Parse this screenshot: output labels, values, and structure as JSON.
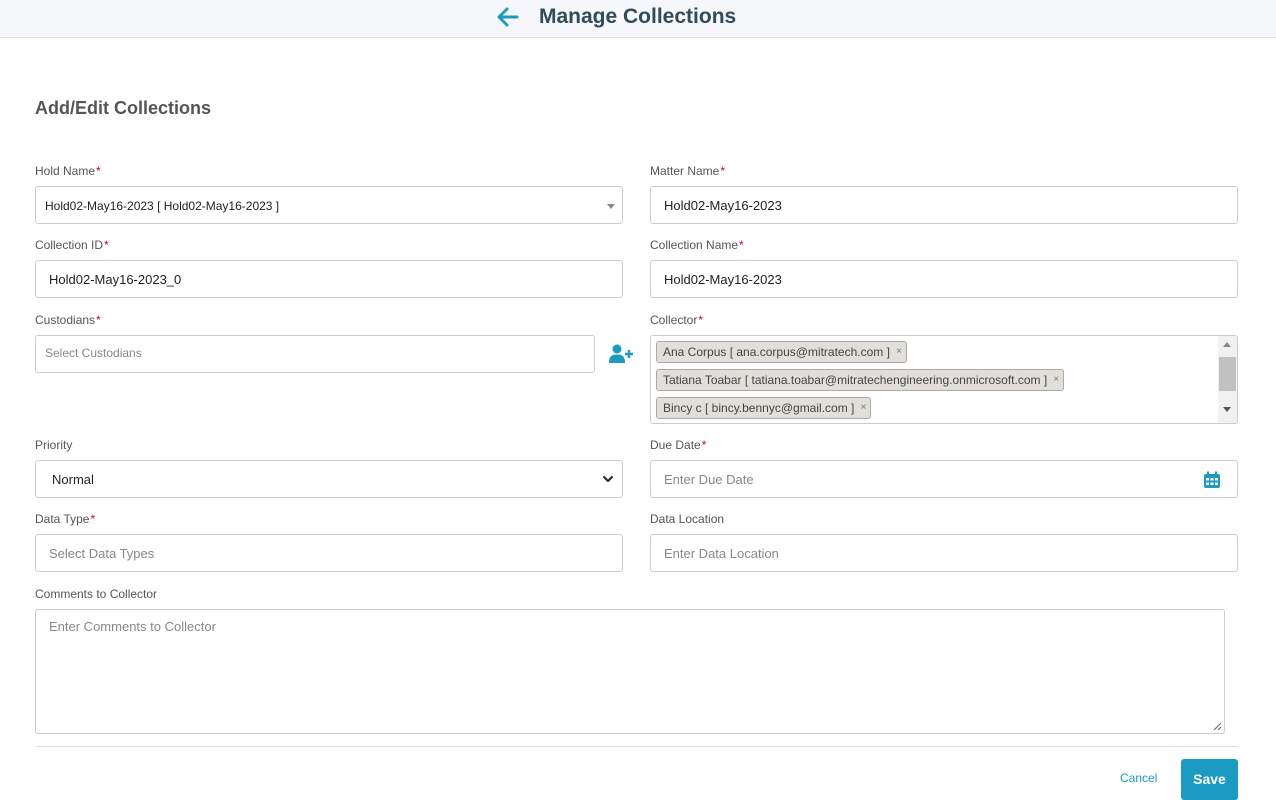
{
  "header": {
    "title": "Manage Collections",
    "back_icon": "arrow-left-icon",
    "accent_color": "#1a9bc3"
  },
  "form": {
    "title": "Add/Edit Collections",
    "hold_name": {
      "label": "Hold Name",
      "required": "*",
      "value": "Hold02-May16-2023 [ Hold02-May16-2023 ]"
    },
    "matter_name": {
      "label": "Matter Name",
      "required": "*",
      "value": "Hold02-May16-2023"
    },
    "collection_id": {
      "label": "Collection ID",
      "required": "*",
      "value": "Hold02-May16-2023_0"
    },
    "collection_name": {
      "label": "Collection Name",
      "required": "*",
      "value": "Hold02-May16-2023"
    },
    "custodians": {
      "label": "Custodians",
      "required": "*",
      "placeholder": "Select Custodians",
      "add_icon": "add-user-icon"
    },
    "collector": {
      "label": "Collector",
      "required": "*",
      "chips": [
        {
          "text": "Ana Corpus [ ana.corpus@mitratech.com ]",
          "remove": "×"
        },
        {
          "text": "Tatiana Toabar [ tatiana.toabar@mitratechengineering.onmicrosoft.com ]",
          "remove": "×"
        },
        {
          "text": "Bincy c [ bincy.bennyc@gmail.com ]",
          "remove": "×"
        }
      ]
    },
    "priority": {
      "label": "Priority",
      "value": "Normal"
    },
    "due_date": {
      "label": "Due Date",
      "required": "*",
      "placeholder": "Enter Due Date",
      "icon": "calendar-icon"
    },
    "data_type": {
      "label": "Data Type",
      "required": "*",
      "placeholder": "Select Data Types"
    },
    "data_location": {
      "label": "Data Location",
      "placeholder": "Enter Data Location"
    },
    "comments": {
      "label": "Comments to Collector",
      "placeholder": "Enter Comments to Collector"
    }
  },
  "actions": {
    "cancel": "Cancel",
    "save": "Save"
  }
}
